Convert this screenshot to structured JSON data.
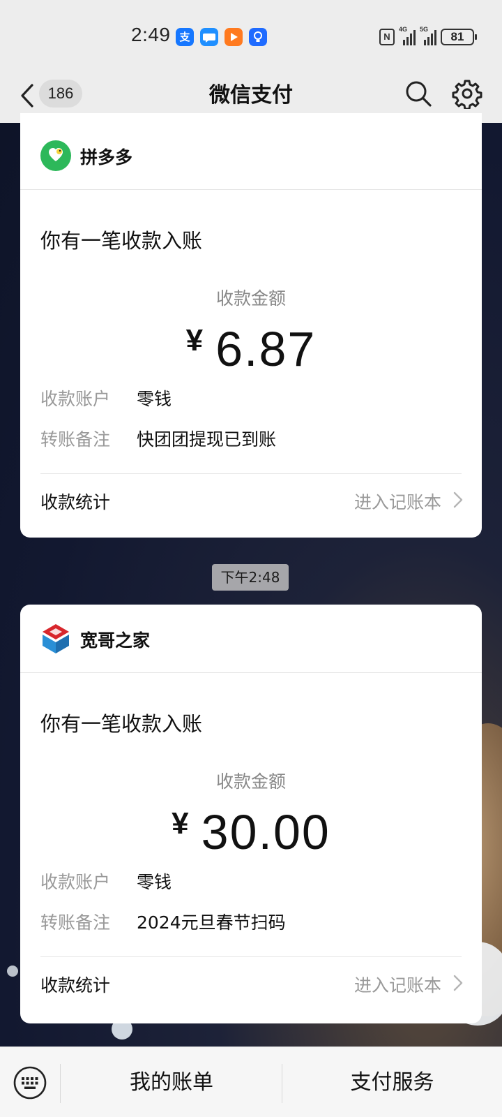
{
  "status_bar": {
    "time": "2:49",
    "apps": [
      "alipay-icon",
      "messages-icon",
      "video-icon",
      "tips-icon"
    ],
    "nfc": "N",
    "signal_1": "4G",
    "signal_2": "5G",
    "battery": "81"
  },
  "header": {
    "back_count": "186",
    "title": "微信支付"
  },
  "messages": [
    {
      "merchant": "拼多多",
      "notice": "你有一笔收款入账",
      "amount_label": "收款金额",
      "currency": "¥",
      "amount": "6.87",
      "account_key": "收款账户",
      "account_value": "零钱",
      "note_key": "转账备注",
      "note_value": "快团团提现已到账",
      "stats_label": "收款统计",
      "stats_link": "进入记账本"
    },
    {
      "merchant": "宽哥之家",
      "notice": "你有一笔收款入账",
      "amount_label": "收款金额",
      "currency": "¥",
      "amount": "30.00",
      "account_key": "收款账户",
      "account_value": "零钱",
      "note_key": "转账备注",
      "note_value": "2024元旦春节扫码",
      "stats_label": "收款统计",
      "stats_link": "进入记账本"
    }
  ],
  "time_chip": "下午2:48",
  "bottom_bar": {
    "bill": "我的账单",
    "service": "支付服务"
  },
  "colors": {
    "pdd_green": "#2db85a",
    "kuange_red": "#d8262c",
    "kuange_blue": "#2a8fd6"
  }
}
